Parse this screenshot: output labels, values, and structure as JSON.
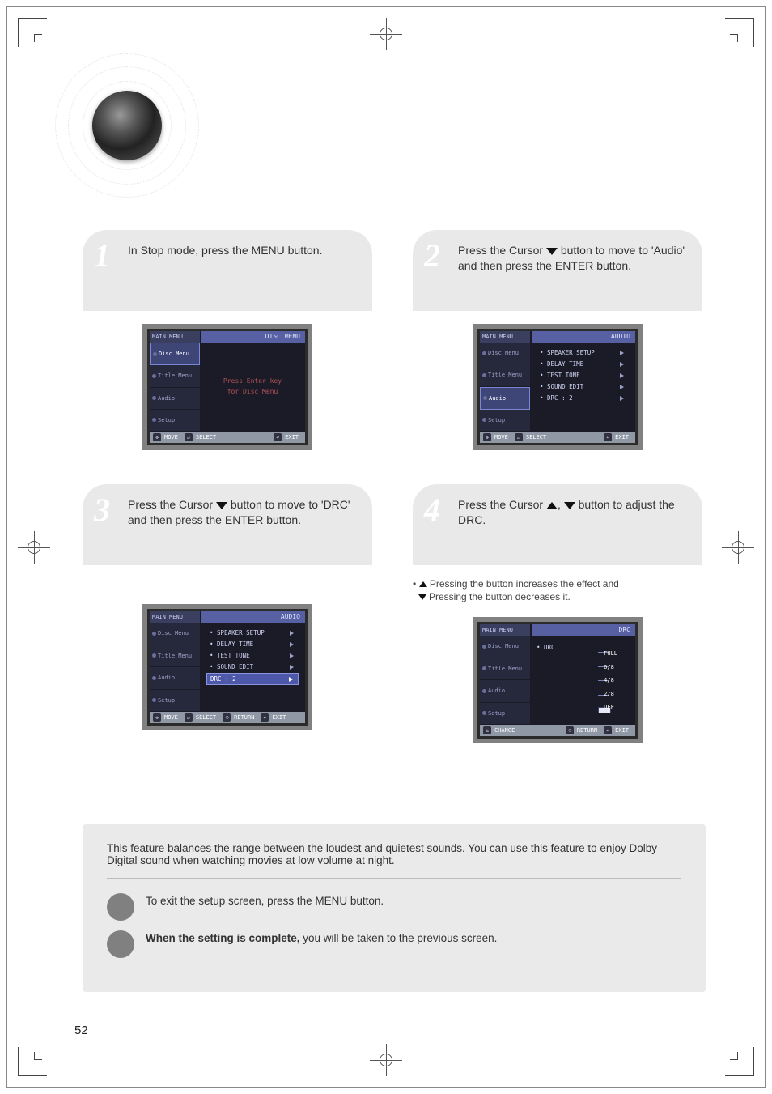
{
  "steps": {
    "s1": {
      "num": "1",
      "text": "In Stop mode, press the MENU button."
    },
    "s2": {
      "num": "2",
      "text_prefix": "Press the Cursor ",
      "text_suffix": " button to move to 'Audio' and then press the ENTER button."
    },
    "s3": {
      "num": "3",
      "text_prefix": "Press the Cursor ",
      "text_suffix": " button to move to 'DRC' and then press the ENTER button."
    },
    "s4": {
      "num": "4",
      "text_prefix": "Press the Cursor ",
      "text_mid": " button to adjust the DRC.",
      "note_up": " Pressing the button increases the effect and",
      "note_down": " Pressing the button decreases it."
    }
  },
  "screens": {
    "scr1": {
      "title": "DISC MENU",
      "side_head": "MAIN MENU",
      "side": [
        "Disc Menu",
        "Title Menu",
        "Audio",
        "Setup"
      ],
      "body_line1": "Press Enter key",
      "body_line2": "for Disc Menu",
      "bottom": {
        "move": "MOVE",
        "select": "SELECT",
        "exit": "EXIT"
      }
    },
    "scr2": {
      "title": "AUDIO",
      "side_head": "MAIN MENU",
      "side": [
        "Disc Menu",
        "Title Menu",
        "Audio",
        "Setup"
      ],
      "list": [
        {
          "label": "SPEAKER SETUP",
          "val": ""
        },
        {
          "label": "DELAY TIME",
          "val": ""
        },
        {
          "label": "TEST TONE",
          "val": ""
        },
        {
          "label": "SOUND EDIT",
          "val": ""
        },
        {
          "label": "DRC",
          "val": ": 2"
        }
      ],
      "bottom": {
        "move": "MOVE",
        "select": "SELECT",
        "exit": "EXIT"
      }
    },
    "scr3": {
      "title": "AUDIO",
      "side_head": "MAIN MENU",
      "side": [
        "Disc Menu",
        "Title Menu",
        "Audio",
        "Setup"
      ],
      "list": [
        {
          "label": "SPEAKER SETUP",
          "val": ""
        },
        {
          "label": "DELAY TIME",
          "val": ""
        },
        {
          "label": "TEST TONE",
          "val": ""
        },
        {
          "label": "SOUND EDIT",
          "val": ""
        },
        {
          "label": "DRC",
          "val": ": 2"
        }
      ],
      "bottom": {
        "move": "MOVE",
        "select": "SELECT",
        "return": "RETURN",
        "exit": "EXIT"
      }
    },
    "scr4": {
      "title": "DRC",
      "side_head": "MAIN MENU",
      "side": [
        "Disc Menu",
        "Title Menu",
        "Audio",
        "Setup"
      ],
      "body_label": "DRC",
      "scale": [
        "FULL",
        "6/8",
        "4/8",
        "2/8",
        "OFF"
      ],
      "bottom": {
        "change": "CHANGE",
        "return": "RETURN",
        "exit": "EXIT"
      }
    }
  },
  "bottom_panel": {
    "intro": "This feature balances the range between the loudest and quietest sounds. You can use this feature to enjoy Dolby Digital sound when watching movies at low volume at night.",
    "b1": "To exit the setup screen, press the MENU button.",
    "b2_bold": "When the setting is complete,",
    "b2_rest": " you will be taken to the previous screen."
  },
  "pagenum": "52"
}
